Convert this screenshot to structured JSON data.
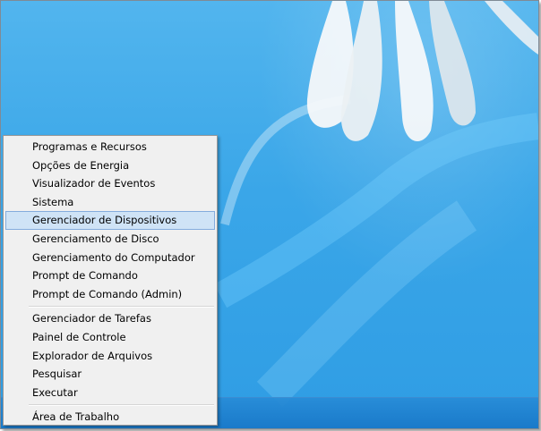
{
  "menu": {
    "group1": [
      "Programas e Recursos",
      "Opções de Energia",
      "Visualizador de Eventos",
      "Sistema",
      "Gerenciador de Dispositivos",
      "Gerenciamento de Disco",
      "Gerenciamento do Computador",
      "Prompt de Comando",
      "Prompt de Comando (Admin)"
    ],
    "group2": [
      "Gerenciador de Tarefas",
      "Painel de Controle",
      "Explorador de Arquivos",
      "Pesquisar",
      "Executar"
    ],
    "group3": [
      "Área de Trabalho"
    ],
    "highlighted_item": "Gerenciador de Dispositivos"
  },
  "colors": {
    "desktop_blue": "#3aa6e8",
    "menu_background": "#f0f0f0",
    "highlight_fill": "#cfe3f6",
    "highlight_border": "#84acdd"
  }
}
